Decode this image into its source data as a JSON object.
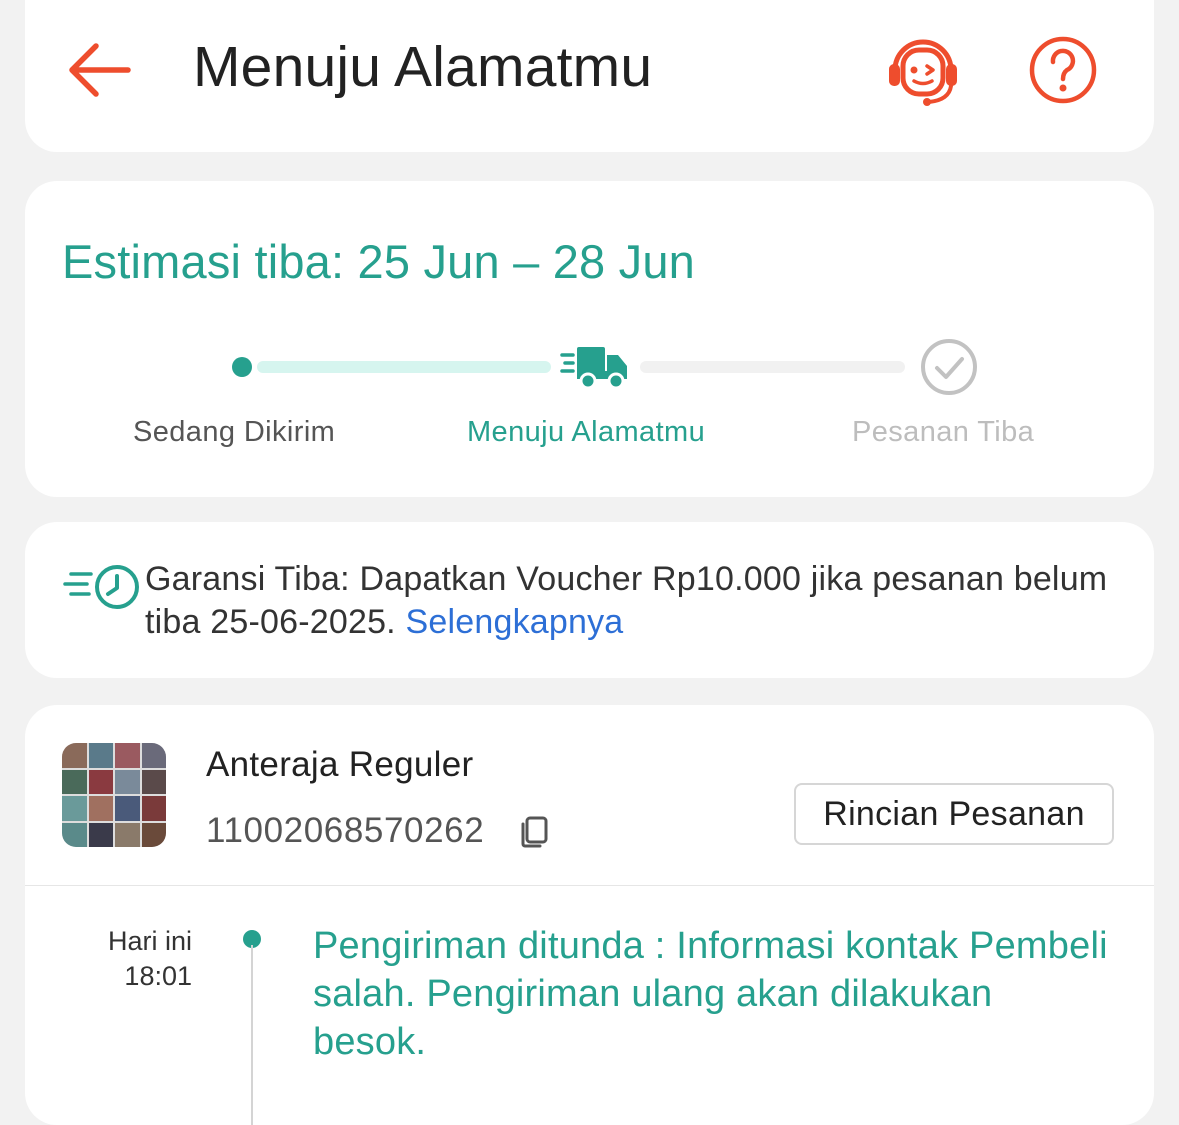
{
  "header": {
    "title": "Menuju Alamatmu",
    "back_icon": "arrow-left-icon",
    "chat_icon": "customer-service-headset-icon",
    "help_icon": "question-circle-icon"
  },
  "estimate": {
    "label": "Estimasi tiba: 25 Jun – 28 Jun",
    "current_step": 2,
    "steps": [
      {
        "label": "Sedang Dikirim",
        "state": "done"
      },
      {
        "label": "Menuju Alamatmu",
        "state": "active",
        "icon": "delivery-truck-icon"
      },
      {
        "label": "Pesanan Tiba",
        "state": "pending",
        "icon": "check-circle-icon"
      }
    ]
  },
  "guarantee": {
    "icon": "fast-clock-icon",
    "text": "Garansi Tiba: Dapatkan Voucher Rp10.000 jika pesanan belum tiba 25-06-2025.",
    "link_label": "Selengkapnya"
  },
  "shipment": {
    "courier": "Anteraja Reguler",
    "tracking_number": "11002068570262",
    "copy_icon": "copy-icon",
    "details_button": "Rincian Pesanan",
    "events": [
      {
        "day": "Hari ini",
        "time": "18:01",
        "text": "Pengiriman ditunda : Informasi kontak Pembeli salah. Pengiriman ulang akan dilakukan besok."
      }
    ]
  },
  "colors": {
    "accent_orange": "#ee4d2d",
    "teal": "#26a08e",
    "link_blue": "#2d6fd6",
    "background": "#f2f2f2"
  }
}
